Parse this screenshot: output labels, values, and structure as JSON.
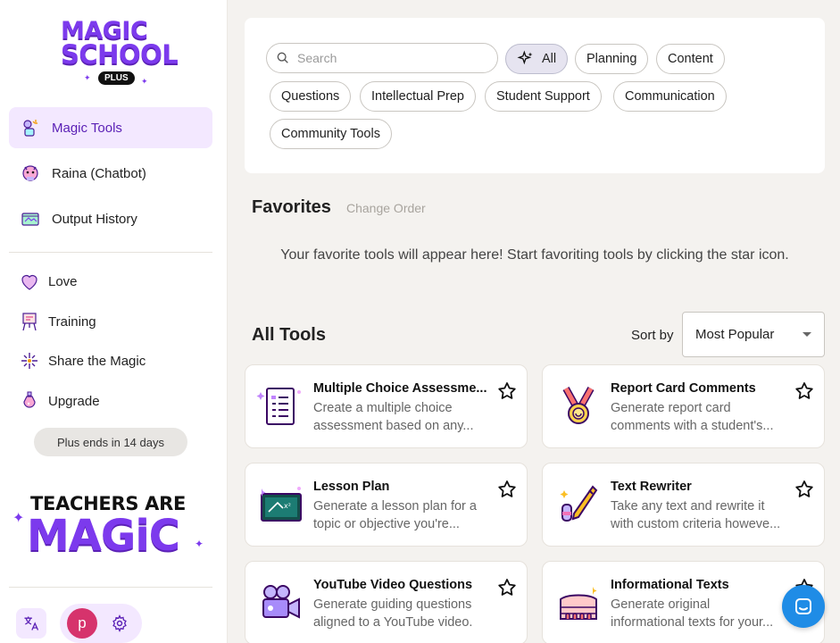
{
  "brand": {
    "line1": "MAGIC",
    "line2": "SCHOOL",
    "badge": "PLUS",
    "accent": "#7c3aed"
  },
  "sidebar": {
    "nav": [
      {
        "label": "Magic Tools",
        "icon": "magic-tools-icon",
        "active": true
      },
      {
        "label": "Raina (Chatbot)",
        "icon": "raina-chatbot-icon"
      },
      {
        "label": "Output History",
        "icon": "output-history-icon"
      }
    ],
    "secondary": [
      {
        "label": "Love",
        "icon": "heart-icon"
      },
      {
        "label": "Training",
        "icon": "easel-icon"
      },
      {
        "label": "Share the Magic",
        "icon": "sparkle-wand-icon"
      },
      {
        "label": "Upgrade",
        "icon": "potion-icon"
      }
    ],
    "plus_status": "Plus ends in 14 days",
    "banner": {
      "line1": "TEACHERS ARE",
      "line2": "MAGiC"
    },
    "profile_initial": "p"
  },
  "filters": {
    "search_placeholder": "Search",
    "chips": [
      "All",
      "Planning",
      "Content",
      "Questions",
      "Intellectual Prep",
      "Student Support",
      "Communication",
      "Community Tools"
    ],
    "selected": "All"
  },
  "favorites": {
    "title": "Favorites",
    "change_order": "Change Order",
    "empty_message": "Your favorite tools will appear here! Start favoriting tools by clicking the star icon."
  },
  "all_tools": {
    "title": "All Tools",
    "sort_label": "Sort by",
    "sort_value": "Most Popular",
    "tools": [
      {
        "name": "Multiple Choice Assessme...",
        "desc": "Create a multiple choice assessment based on any...",
        "icon": "quiz-sheet-icon"
      },
      {
        "name": "Report Card Comments",
        "desc": "Generate report card comments with a student's...",
        "icon": "medal-icon"
      },
      {
        "name": "Lesson Plan",
        "desc": "Generate a lesson plan for a topic or objective you're...",
        "icon": "chalkboard-icon"
      },
      {
        "name": "Text Rewriter",
        "desc": "Take any text and rewrite it with custom criteria howeve...",
        "icon": "pencil-eraser-icon"
      },
      {
        "name": "YouTube Video Questions",
        "desc": "Generate guiding questions aligned to a YouTube video.",
        "icon": "video-camera-icon"
      },
      {
        "name": "Informational Texts",
        "desc": "Generate original informational texts for your...",
        "icon": "colosseum-icon"
      }
    ]
  }
}
